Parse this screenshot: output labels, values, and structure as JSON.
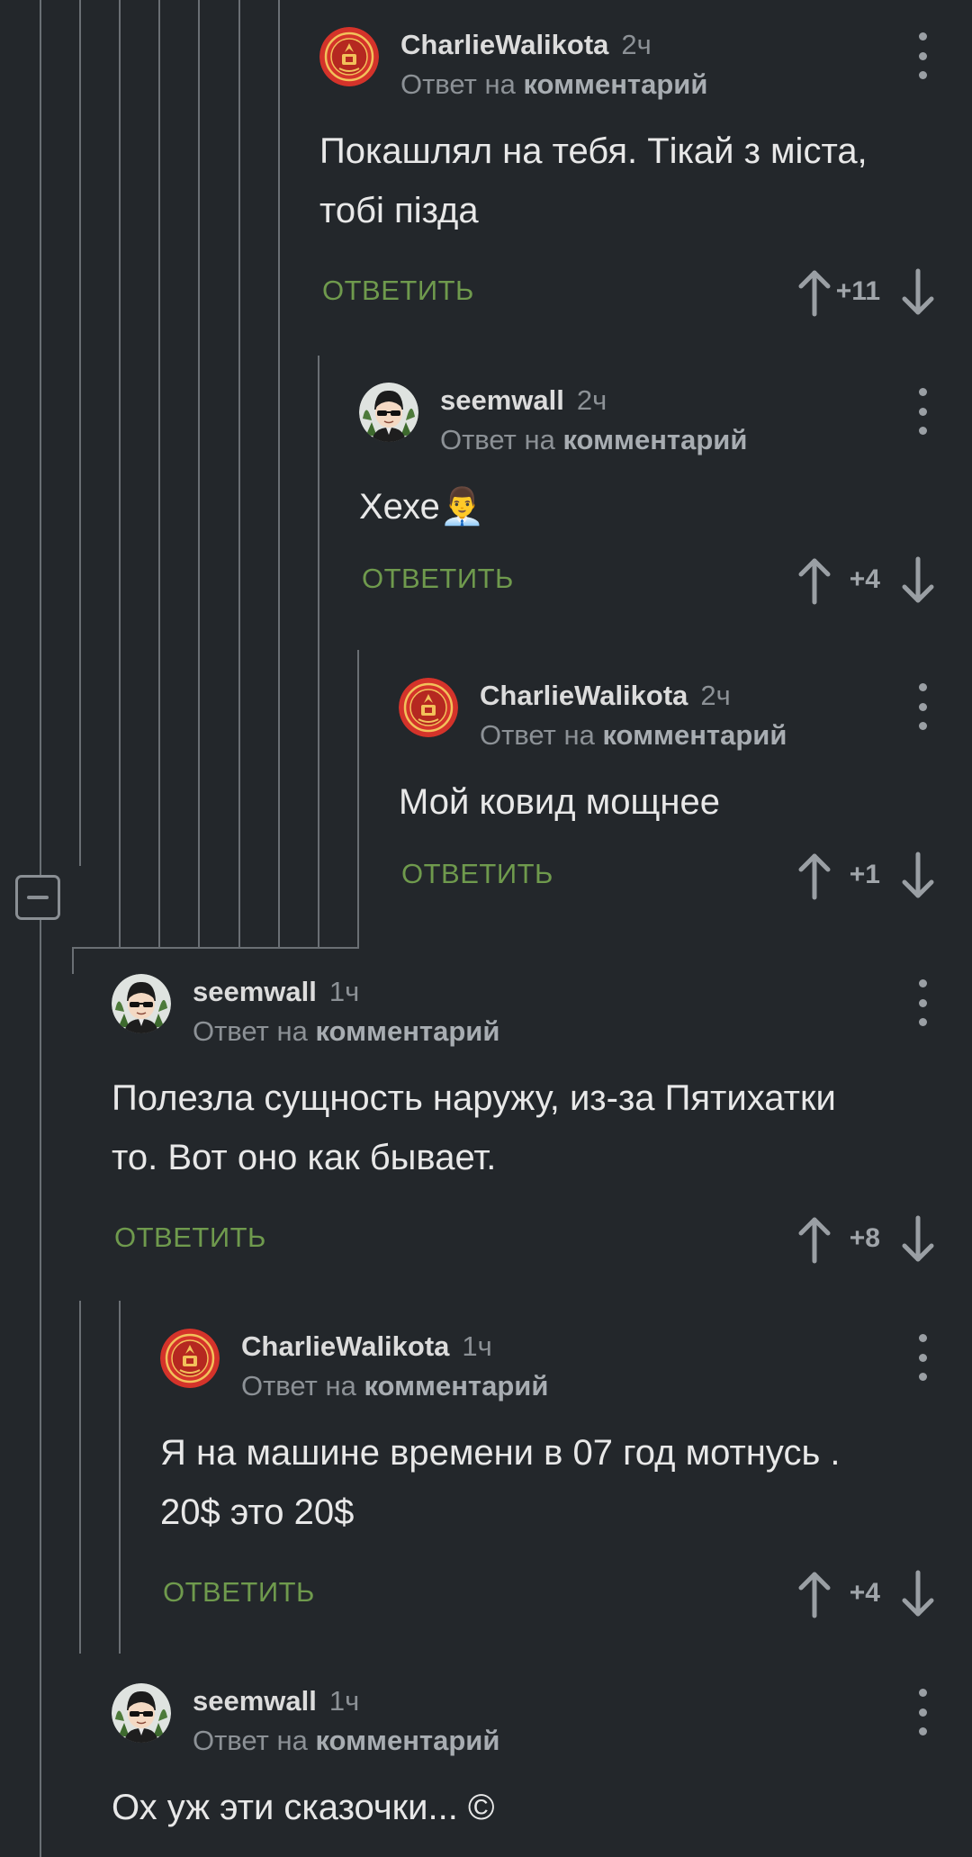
{
  "comments": [
    {
      "user": "CharlieWalikota",
      "avatar": "emblem",
      "time": "2ч",
      "reply_prefix": "Ответ на",
      "reply_target": "комментарий",
      "lines": [
        "Покашлял на тебя. Тікай з міста,",
        "тобі пізда"
      ],
      "reply_label": "ОТВЕТИТЬ",
      "score": "+11"
    },
    {
      "user": "seemwall",
      "avatar": "cartoon",
      "time": "2ч",
      "reply_prefix": "Ответ на",
      "reply_target": "комментарий",
      "lines": [
        "Хехе👨‍💼"
      ],
      "reply_label": "ОТВЕТИТЬ",
      "score": "+4"
    },
    {
      "user": "CharlieWalikota",
      "avatar": "emblem",
      "time": "2ч",
      "reply_prefix": "Ответ на",
      "reply_target": "комментарий",
      "lines": [
        "Мой ковид мощнее"
      ],
      "reply_label": "ОТВЕТИТЬ",
      "score": "+1"
    },
    {
      "user": "seemwall",
      "avatar": "cartoon",
      "time": "1ч",
      "reply_prefix": "Ответ на",
      "reply_target": "комментарий",
      "lines": [
        "Полезла сущность наружу, из-за Пятихатки",
        "то. Вот оно как бывает."
      ],
      "reply_label": "ОТВЕТИТЬ",
      "score": "+8"
    },
    {
      "user": "CharlieWalikota",
      "avatar": "emblem",
      "time": "1ч",
      "reply_prefix": "Ответ на",
      "reply_target": "комментарий",
      "lines": [
        "Я на машине времени в 07 год мотнусь .",
        "20$ это 20$"
      ],
      "reply_label": "ОТВЕТИТЬ",
      "score": "+4"
    },
    {
      "user": "seemwall",
      "avatar": "cartoon",
      "time": "1ч",
      "reply_prefix": "Ответ на",
      "reply_target": "комментарий",
      "lines": [
        "Ох уж эти сказочки... ©"
      ],
      "reply_label": "",
      "score": ""
    }
  ],
  "icons": {
    "collapse": "collapse-minus-icon",
    "up": "arrow-up-icon",
    "down": "arrow-down-icon",
    "more": "more-vertical-icon"
  },
  "colors": {
    "background": "#23272b",
    "reply_action": "#6f9a4d",
    "thread_line": "#6a6f74",
    "emblem": "#d4332a"
  }
}
